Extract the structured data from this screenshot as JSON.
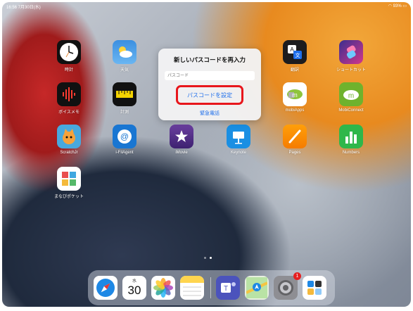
{
  "status_bar": {
    "time_date": "16:56  7月30日(水)",
    "battery": "93%"
  },
  "home_apps": [
    {
      "name": "時計"
    },
    {
      "name": "天気"
    },
    {
      "name": "翻訳"
    },
    {
      "name": "ショートカット"
    },
    {
      "name": "ボイスメモ"
    },
    {
      "name": "計測"
    },
    {
      "name": "mobiApps"
    },
    {
      "name": "MobiConnect"
    },
    {
      "name": "ScratchJr"
    },
    {
      "name": "i-FilAgent"
    },
    {
      "name": "iMovie"
    },
    {
      "name": "Keynote"
    },
    {
      "name": "Pages"
    },
    {
      "name": "Numbers"
    },
    {
      "name": "まなびポケット"
    }
  ],
  "dialog": {
    "title": "新しいパスコードを再入力",
    "passcode_placeholder": "パスコード",
    "set_button": "パスコードを設定",
    "emergency_call": "緊急電話"
  },
  "dock": {
    "calendar_day": "30",
    "calendar_weekday": "水",
    "notification_badge": "1"
  },
  "colors": {
    "highlight_border": "#e8161c",
    "link_blue": "#1f6feb"
  }
}
